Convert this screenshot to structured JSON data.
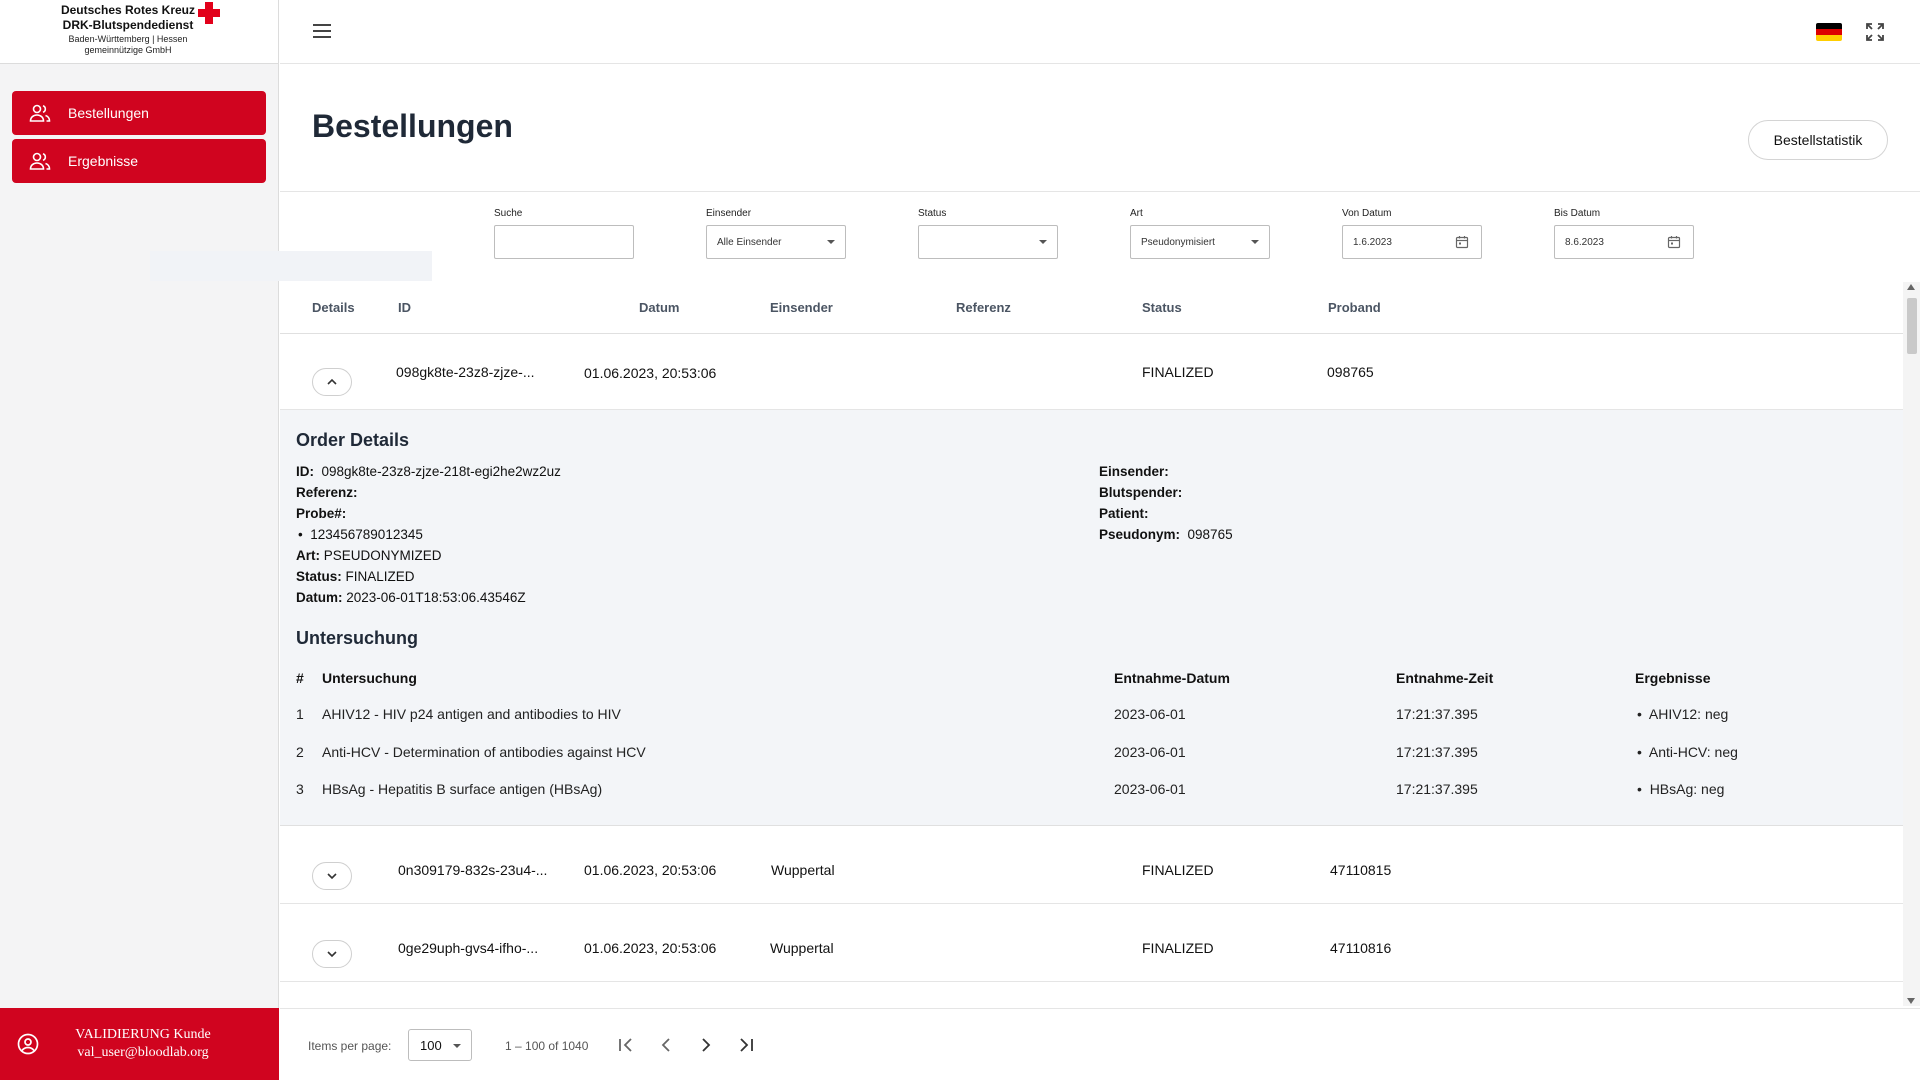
{
  "brand": {
    "line1": "Deutsches Rotes Kreuz",
    "line2": "DRK-Blutspendedienst",
    "line3": "Baden-Württemberg | Hessen",
    "line4": "gemeinnützige GmbH",
    "accent_color": "#d0041f"
  },
  "sidebar": {
    "items": [
      {
        "label": "Bestellungen",
        "icon": "users-icon"
      },
      {
        "label": "Ergebnisse",
        "icon": "users-icon"
      }
    ],
    "user": {
      "name": "VALIDIERUNG Kunde",
      "email": "val_user@bloodlab.org"
    }
  },
  "page": {
    "title": "Bestellungen",
    "stat_button": "Bestellstatistik"
  },
  "filters": {
    "search": {
      "label": "Suche",
      "value": ""
    },
    "einsender": {
      "label": "Einsender",
      "value": "Alle Einsender"
    },
    "status": {
      "label": "Status",
      "value": ""
    },
    "art": {
      "label": "Art",
      "value": "Pseudonymisiert"
    },
    "von": {
      "label": "Von Datum",
      "value": "1.6.2023"
    },
    "bis": {
      "label": "Bis Datum",
      "value": "8.6.2023"
    }
  },
  "table": {
    "columns": [
      "Details",
      "ID",
      "Datum",
      "Einsender",
      "Referenz",
      "Status",
      "Proband"
    ],
    "rows": [
      {
        "id": "098gk8te-23z8-zjze-...",
        "datum": "01.06.2023, 20:53:06",
        "einsender": "",
        "referenz": "",
        "status": "FINALIZED",
        "proband": "098765"
      },
      {
        "id": "0n309179-832s-23u4-...",
        "datum": "01.06.2023, 20:53:06",
        "einsender": "Wuppertal",
        "referenz": "",
        "status": "FINALIZED",
        "proband": "47110815"
      },
      {
        "id": "0ge29uph-gvs4-ifho-...",
        "datum": "01.06.2023, 20:53:06",
        "einsender": "Wuppertal",
        "referenz": "",
        "status": "FINALIZED",
        "proband": "47110816"
      }
    ]
  },
  "details": {
    "title": "Order Details",
    "id_label": "ID:",
    "id_value": "098gk8te-23z8-zjze-218t-egi2he2wz2uz",
    "referenz_label": "Referenz:",
    "probe_label": "Probe#:",
    "probe_item": "123456789012345",
    "art_label": "Art:",
    "art_value": "PSEUDONYMIZED",
    "status_label": "Status:",
    "status_value": "FINALIZED",
    "datum_label": "Datum:",
    "datum_value": "2023-06-01T18:53:06.43546Z",
    "einsender_label": "Einsender:",
    "blutspender_label": "Blutspender:",
    "patient_label": "Patient:",
    "pseudonym_label": "Pseudonym:",
    "pseudonym_value": "098765",
    "untersuchung_title": "Untersuchung",
    "ut_columns": [
      "#",
      "Untersuchung",
      "Entnahme-Datum",
      "Entnahme-Zeit",
      "Ergebnisse"
    ],
    "ut_rows": [
      {
        "n": "1",
        "name": "AHIV12 - HIV p24 antigen and antibodies to HIV",
        "date": "2023-06-01",
        "time": "17:21:37.395",
        "result": "AHIV12: neg"
      },
      {
        "n": "2",
        "name": "Anti-HCV - Determination of antibodies against HCV",
        "date": "2023-06-01",
        "time": "17:21:37.395",
        "result": "Anti-HCV: neg"
      },
      {
        "n": "3",
        "name": "HBsAg - Hepatitis B surface antigen (HBsAg)",
        "date": "2023-06-01",
        "time": "17:21:37.395",
        "result": "HBsAg: neg"
      }
    ]
  },
  "paginator": {
    "label": "Items per page:",
    "page_size": "100",
    "range": "1 – 100 of 1040"
  }
}
